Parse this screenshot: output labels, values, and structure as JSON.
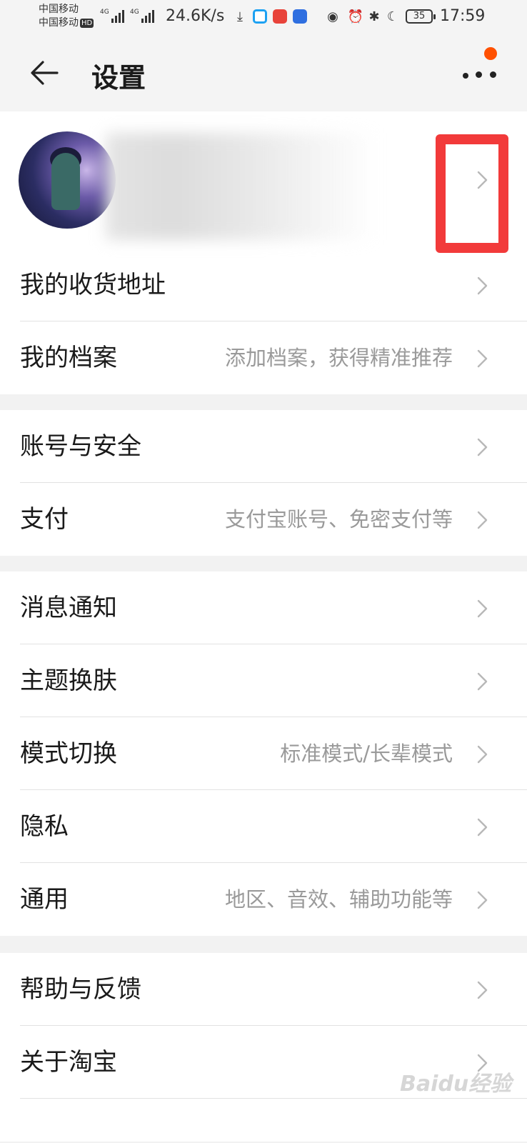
{
  "status_bar": {
    "carrier_1": "中国移动",
    "carrier_2": "中国移动",
    "hd_badge": "HD",
    "network_type_1": "4G",
    "network_type_2": "4G",
    "net_speed": "24.6K/s",
    "battery": "35",
    "time": "17:59"
  },
  "header": {
    "title": "设置"
  },
  "groups": [
    {
      "items": [
        {
          "label": "我的收货地址",
          "desc": ""
        },
        {
          "label": "我的档案",
          "desc": "添加档案，获得精准推荐"
        }
      ]
    },
    {
      "items": [
        {
          "label": "账号与安全",
          "desc": ""
        },
        {
          "label": "支付",
          "desc": "支付宝账号、免密支付等"
        }
      ]
    },
    {
      "items": [
        {
          "label": "消息通知",
          "desc": ""
        },
        {
          "label": "主题换肤",
          "desc": ""
        },
        {
          "label": "模式切换",
          "desc": "标准模式/长辈模式"
        },
        {
          "label": "隐私",
          "desc": ""
        },
        {
          "label": "通用",
          "desc": "地区、音效、辅助功能等"
        }
      ]
    },
    {
      "items": [
        {
          "label": "帮助与反馈",
          "desc": ""
        },
        {
          "label": "关于淘宝",
          "desc": ""
        }
      ]
    }
  ],
  "watermark": "Baidu经验",
  "colors": {
    "accent_notify": "#ff5000",
    "highlight_box": "#f23a3a",
    "page_bg": "#f2f2f2",
    "secondary_text": "#9a9a9a"
  }
}
